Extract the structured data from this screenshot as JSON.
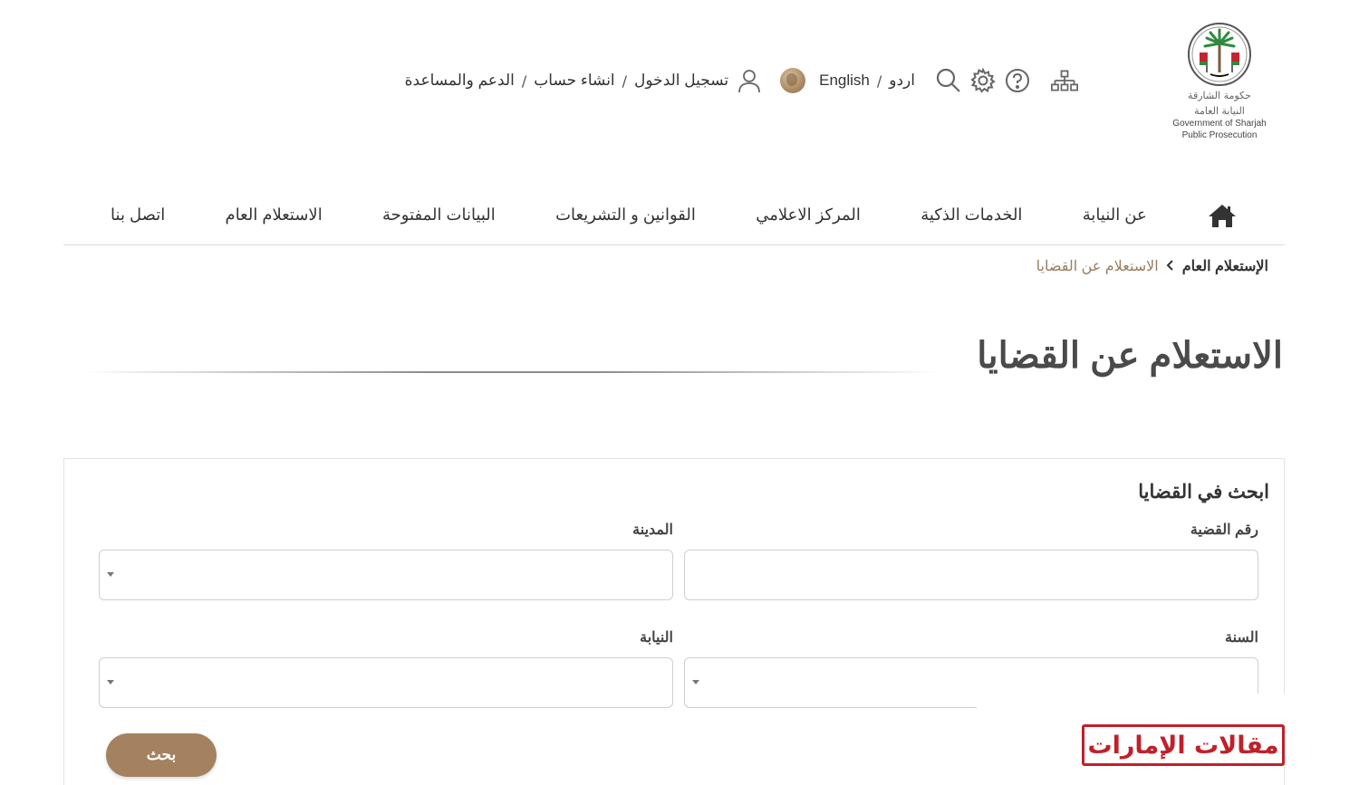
{
  "header": {
    "logo": {
      "arabic_line1": "حكومة الشارقة",
      "arabic_line2": "النيابة العامة",
      "english_line1": "Government of Sharjah",
      "english_line2": "Public Prosecution",
      "colors": {
        "green": "#2e8b3d",
        "red": "#c8232c",
        "black": "#111111"
      }
    },
    "utility": {
      "icons": [
        "sitemap-icon",
        "help-icon",
        "settings-icon",
        "search-icon",
        "globe-icon",
        "user-icon"
      ],
      "lang_urdu": "اردو",
      "lang_sep": "/",
      "lang_english": "English",
      "login": "تسجيل الدخول",
      "sep": "/",
      "register": "انشاء حساب",
      "support": "الدعم والمساعدة"
    }
  },
  "nav": {
    "home_icon": "home-icon",
    "items": [
      "عن النيابة",
      "الخدمات الذكية",
      "المركز الاعلامي",
      "القوانين و التشريعات",
      "البيانات المفتوحة",
      "الاستعلام العام",
      "اتصل بنا"
    ]
  },
  "breadcrumb": {
    "parent": "الإستعلام العام",
    "current": "الاستعلام عن القضايا"
  },
  "page": {
    "title": "الاستعلام عن القضايا"
  },
  "search_form": {
    "heading": "ابحث في القضايا",
    "case_number_label": "رقم القضية",
    "case_number_value": "",
    "city_label": "المدينة",
    "city_value": "",
    "year_label": "السنة",
    "year_value": "",
    "prosecution_label": "النيابة",
    "prosecution_value": "",
    "submit_label": "بحث"
  },
  "watermark": {
    "text": "مقالات الإمارات",
    "color": "#c0202a"
  },
  "colors": {
    "accent": "#a4825f",
    "breadcrumb_current": "#9b7b5d",
    "text": "#333333",
    "border": "#cfcfcf"
  }
}
